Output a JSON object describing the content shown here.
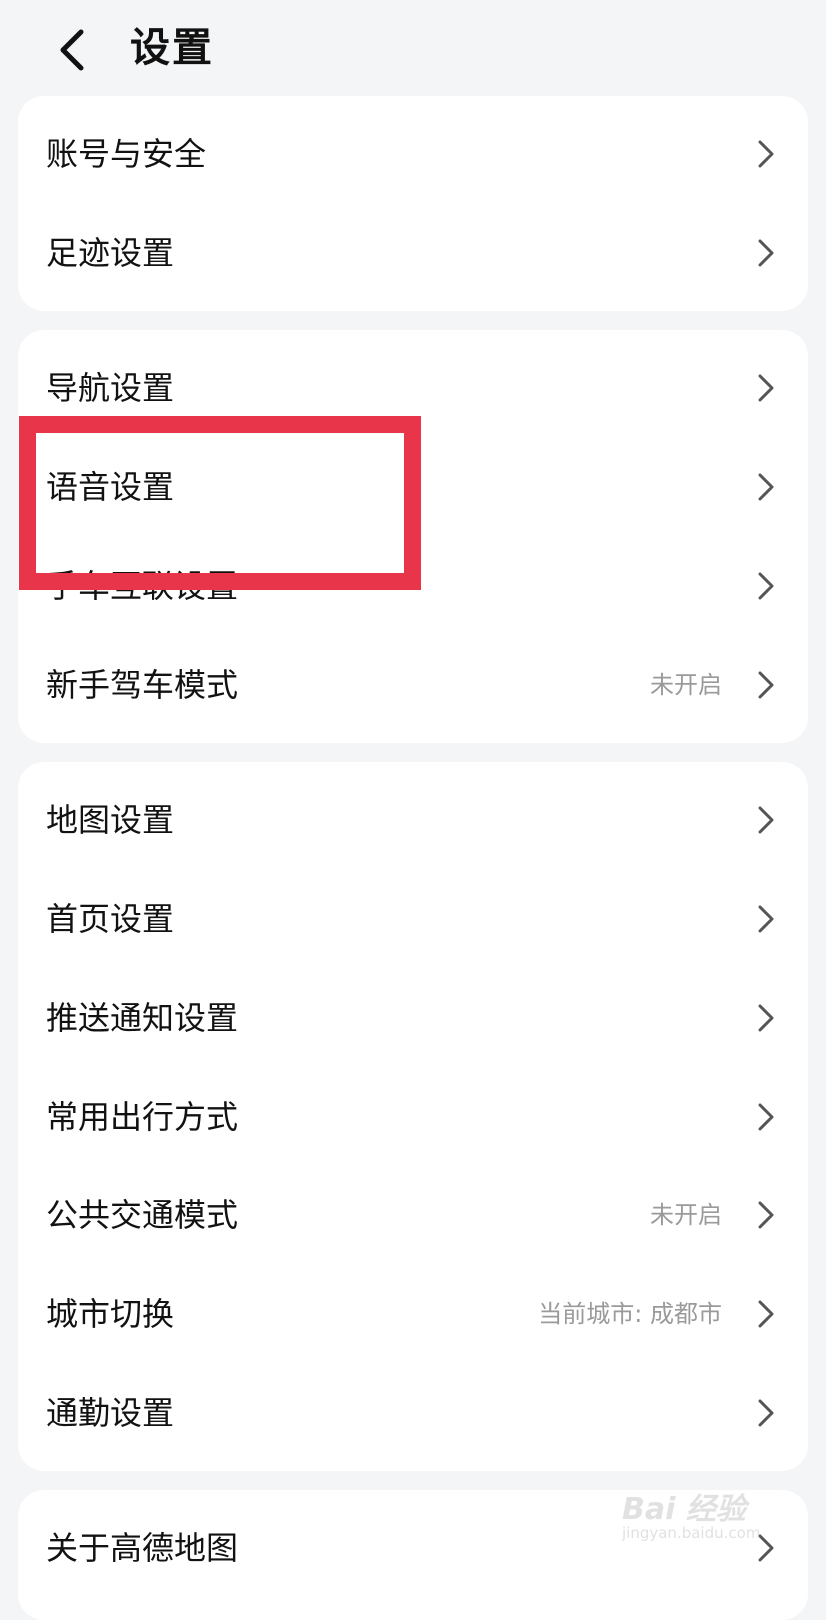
{
  "header": {
    "back_icon": "chevron-left-icon",
    "title": "设置"
  },
  "groups": [
    {
      "rows": [
        {
          "label": "账号与安全",
          "value": ""
        },
        {
          "label": "足迹设置",
          "value": ""
        }
      ]
    },
    {
      "rows": [
        {
          "label": "导航设置",
          "value": ""
        },
        {
          "label": "语音设置",
          "value": ""
        },
        {
          "label": "手车互联设置",
          "value": ""
        },
        {
          "label": "新手驾车模式",
          "value": "未开启"
        }
      ]
    },
    {
      "rows": [
        {
          "label": "地图设置",
          "value": ""
        },
        {
          "label": "首页设置",
          "value": ""
        },
        {
          "label": "推送通知设置",
          "value": ""
        },
        {
          "label": "常用出行方式",
          "value": ""
        },
        {
          "label": "公共交通模式",
          "value": "未开启"
        },
        {
          "label": "城市切换",
          "value": "当前城市: 成都市"
        },
        {
          "label": "通勤设置",
          "value": ""
        }
      ]
    },
    {
      "rows": [
        {
          "label": "关于高德地图",
          "value": ""
        }
      ]
    }
  ],
  "annotation": {
    "highlight_color": "#e8354a"
  },
  "watermark": {
    "line1": "Bai 经验",
    "line2": "jingyan.baidu.com"
  },
  "colors": {
    "background": "#f4f5f7",
    "card": "#ffffff",
    "secondary_text": "#9a9a9a"
  }
}
